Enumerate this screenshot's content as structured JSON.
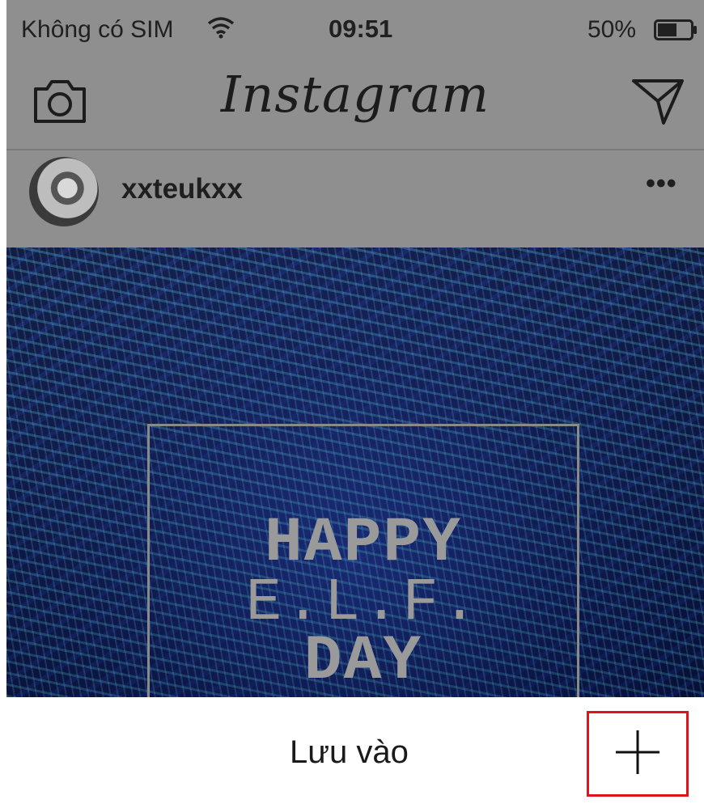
{
  "status_bar": {
    "carrier": "Không có SIM",
    "time": "09:51",
    "battery_percent": "50%",
    "icons": [
      "wifi-icon",
      "battery-icon"
    ]
  },
  "navbar": {
    "logo": "Instagram",
    "icons": [
      "camera-icon",
      "direct-send-icon"
    ]
  },
  "post": {
    "username": "xxteukxx",
    "more": "•••",
    "image_text": {
      "line1": "HAPPY",
      "line2": "E.L.F.",
      "line3": "DAY"
    }
  },
  "save_bar": {
    "label": "Lưu vào",
    "add_icon": "plus-icon",
    "highlight_color": "#e0141b"
  }
}
